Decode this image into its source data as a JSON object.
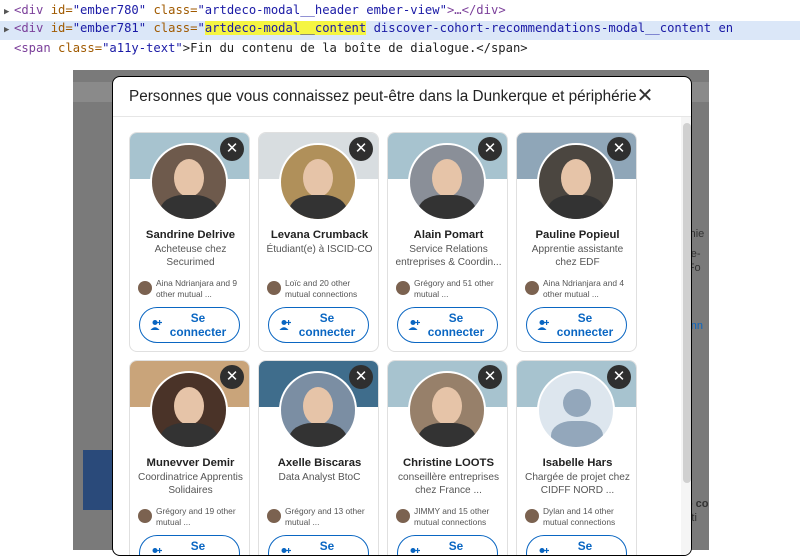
{
  "devtools": {
    "line1": {
      "open": "<div",
      "id_attr": "id=",
      "id_val": "\"ember780\"",
      "class_attr": "class=",
      "class_val": "\"artdeco-modal__header ember-view\"",
      "rest": ">…</div>"
    },
    "line2": {
      "open": "<div",
      "id_attr": "id=",
      "id_val": "\"ember781\"",
      "class_attr": "class=",
      "q": "\"",
      "class_hl": "artdeco-modal__content",
      "class_rest": " discover-cohort-recommendations-modal__content en"
    },
    "line3": {
      "open": "<span",
      "class_attr": "class=",
      "class_val": "\"a11y-text\"",
      "text": ">Fin du contenu de la boîte de dialogue.</span>"
    }
  },
  "background": {
    "peek": [
      "Sophie",
      "atrice-",
      "bal Fo",
      "e conn",
      "ome co",
      "arketi"
    ]
  },
  "modal": {
    "title": "Personnes que vous connaissez peut-être dans la Dunkerque et périphérie",
    "close_label": "✕",
    "dismiss_label": "✕",
    "connect_label": "Se connecter",
    "people": [
      {
        "name": "Sandrine Delrive",
        "headline": "Acheteuse chez Securimed",
        "mutual": "Aina Ndrianjara and 9 other mutual ...",
        "avatar": "#6e5a4c",
        "banner": "#a7c3cf"
      },
      {
        "name": "Levana Crumback",
        "headline": "Étudiant(e) à ISCID-CO",
        "mutual": "Loïc and 20 other mutual connections",
        "avatar": "#b0905a",
        "banner": "#d8dde0"
      },
      {
        "name": "Alain Pomart",
        "headline": "Service Relations entreprises & Coordin...",
        "mutual": "Grégory and 51 other mutual ...",
        "avatar": "#8a8f98",
        "banner": "#a7c3cf"
      },
      {
        "name": "Pauline Popieul",
        "headline": "Apprentie assistante chez EDF",
        "mutual": "Aina Ndrianjara and 4 other mutual ...",
        "avatar": "#4b4640",
        "banner": "#8fa6b8"
      },
      {
        "name": "Munevver Demir",
        "headline": "Coordinatrice Apprentis Solidaires",
        "mutual": "Grégory and 19 other mutual ...",
        "avatar": "#4a3328",
        "banner": "#c9a47a"
      },
      {
        "name": "Axelle Biscaras",
        "headline": "Data Analyst BtoC",
        "mutual": "Grégory and 13 other mutual ...",
        "avatar": "#7b8ea3",
        "banner": "#3f6d8c"
      },
      {
        "name": "Christine LOOTS",
        "headline": "conseillère entreprises chez France ...",
        "mutual": "JIMMY and 15 other mutual connections",
        "avatar": "#97806a",
        "banner": "#a7c3cf"
      },
      {
        "name": "Isabelle Hars",
        "headline": "Chargée de projet chez CIDFF NORD ...",
        "mutual": "Dylan and 14 other mutual connections",
        "avatar": "default",
        "banner": "#a7c3cf"
      }
    ]
  }
}
